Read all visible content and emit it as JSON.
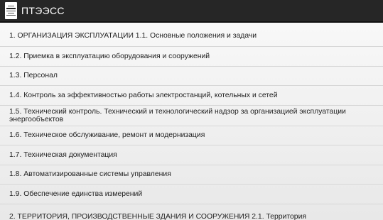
{
  "app_bar": {
    "title": "ПТЭЭСС",
    "icon": "document-book-icon"
  },
  "toc": {
    "items": [
      "1. ОРГАНИЗАЦИЯ ЭКСПЛУАТАЦИИ 1.1. Основные положения и задачи",
      "1.2. Приемка в эксплуатацию оборудования и сооружений",
      "1.3. Персонал",
      "1.4. Контроль за эффективностью работы электростанций, котельных и сетей",
      "1.5. Технический контроль. Технический и технологический надзор за организацией эксплуатации энергообъектов",
      "1.6. Техническое обслуживание, ремонт и модернизация",
      "1.7. Техническая документация",
      "1.8. Автоматизированные системы управления",
      "1.9. Обеспечение единства измерений",
      "2. ТЕРРИТОРИЯ, ПРОИЗВОДСТВЕННЫЕ ЗДАНИЯ И СООРУЖЕНИЯ 2.1. Территория"
    ]
  },
  "colors": {
    "action_bar": "#262626",
    "divider": "#d6d6d6",
    "text": "#222222"
  }
}
